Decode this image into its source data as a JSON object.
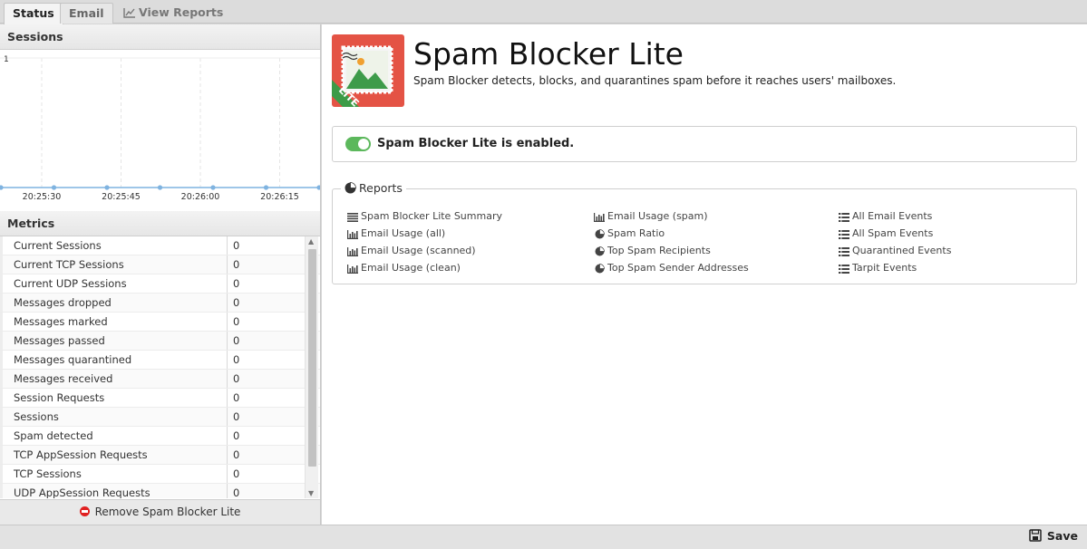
{
  "tabs": [
    {
      "label": "Status",
      "active": true
    },
    {
      "label": "Email",
      "active": false
    },
    {
      "label": "View Reports",
      "icon": "line-chart-icon",
      "active": false
    }
  ],
  "sessions": {
    "title": "Sessions",
    "chart_data": {
      "type": "line",
      "title": "",
      "x": [
        "20:25:30",
        "20:25:45",
        "20:26:00",
        "20:26:15"
      ],
      "ytick_labels": [
        "1"
      ],
      "series": [
        {
          "values": [
            0,
            0,
            0,
            0,
            0,
            0,
            0
          ]
        }
      ],
      "ylim": [
        0,
        1
      ],
      "grid": true,
      "colors": {
        "line": "#7fb3e0"
      }
    }
  },
  "metrics": {
    "title": "Metrics",
    "rows": [
      {
        "label": "Current Sessions",
        "value": "0"
      },
      {
        "label": "Current TCP Sessions",
        "value": "0"
      },
      {
        "label": "Current UDP Sessions",
        "value": "0"
      },
      {
        "label": "Messages dropped",
        "value": "0"
      },
      {
        "label": "Messages marked",
        "value": "0"
      },
      {
        "label": "Messages passed",
        "value": "0"
      },
      {
        "label": "Messages quarantined",
        "value": "0"
      },
      {
        "label": "Messages received",
        "value": "0"
      },
      {
        "label": "Session Requests",
        "value": "0"
      },
      {
        "label": "Sessions",
        "value": "0"
      },
      {
        "label": "Spam detected",
        "value": "0"
      },
      {
        "label": "TCP AppSession Requests",
        "value": "0"
      },
      {
        "label": "TCP Sessions",
        "value": "0"
      },
      {
        "label": "UDP AppSession Requests",
        "value": "0"
      }
    ],
    "remove_label": "Remove Spam Blocker Lite"
  },
  "app": {
    "title": "Spam Blocker Lite",
    "description": "Spam Blocker detects, blocks, and quarantines spam before it reaches users' mailboxes.",
    "badge": "LITE",
    "enabled_text": "Spam Blocker Lite is enabled.",
    "colors": {
      "icon_bg": "#e45345",
      "badge": "#3d9b47",
      "toggle": "#5cb85c"
    }
  },
  "reports": {
    "title": "Reports",
    "columns": [
      [
        {
          "icon": "list-icon",
          "label": "Spam Blocker Lite Summary"
        },
        {
          "icon": "bar-chart-icon",
          "label": "Email Usage (all)"
        },
        {
          "icon": "bar-chart-icon",
          "label": "Email Usage (scanned)"
        },
        {
          "icon": "bar-chart-icon",
          "label": "Email Usage (clean)"
        }
      ],
      [
        {
          "icon": "bar-chart-icon",
          "label": "Email Usage (spam)"
        },
        {
          "icon": "pie-chart-icon",
          "label": "Spam Ratio"
        },
        {
          "icon": "pie-chart-icon",
          "label": "Top Spam Recipients"
        },
        {
          "icon": "pie-chart-icon",
          "label": "Top Spam Sender Addresses"
        }
      ],
      [
        {
          "icon": "bullet-list-icon",
          "label": "All Email Events"
        },
        {
          "icon": "bullet-list-icon",
          "label": "All Spam Events"
        },
        {
          "icon": "bullet-list-icon",
          "label": "Quarantined Events"
        },
        {
          "icon": "bullet-list-icon",
          "label": "Tarpit Events"
        }
      ]
    ]
  },
  "toolbar": {
    "save_label": "Save"
  }
}
